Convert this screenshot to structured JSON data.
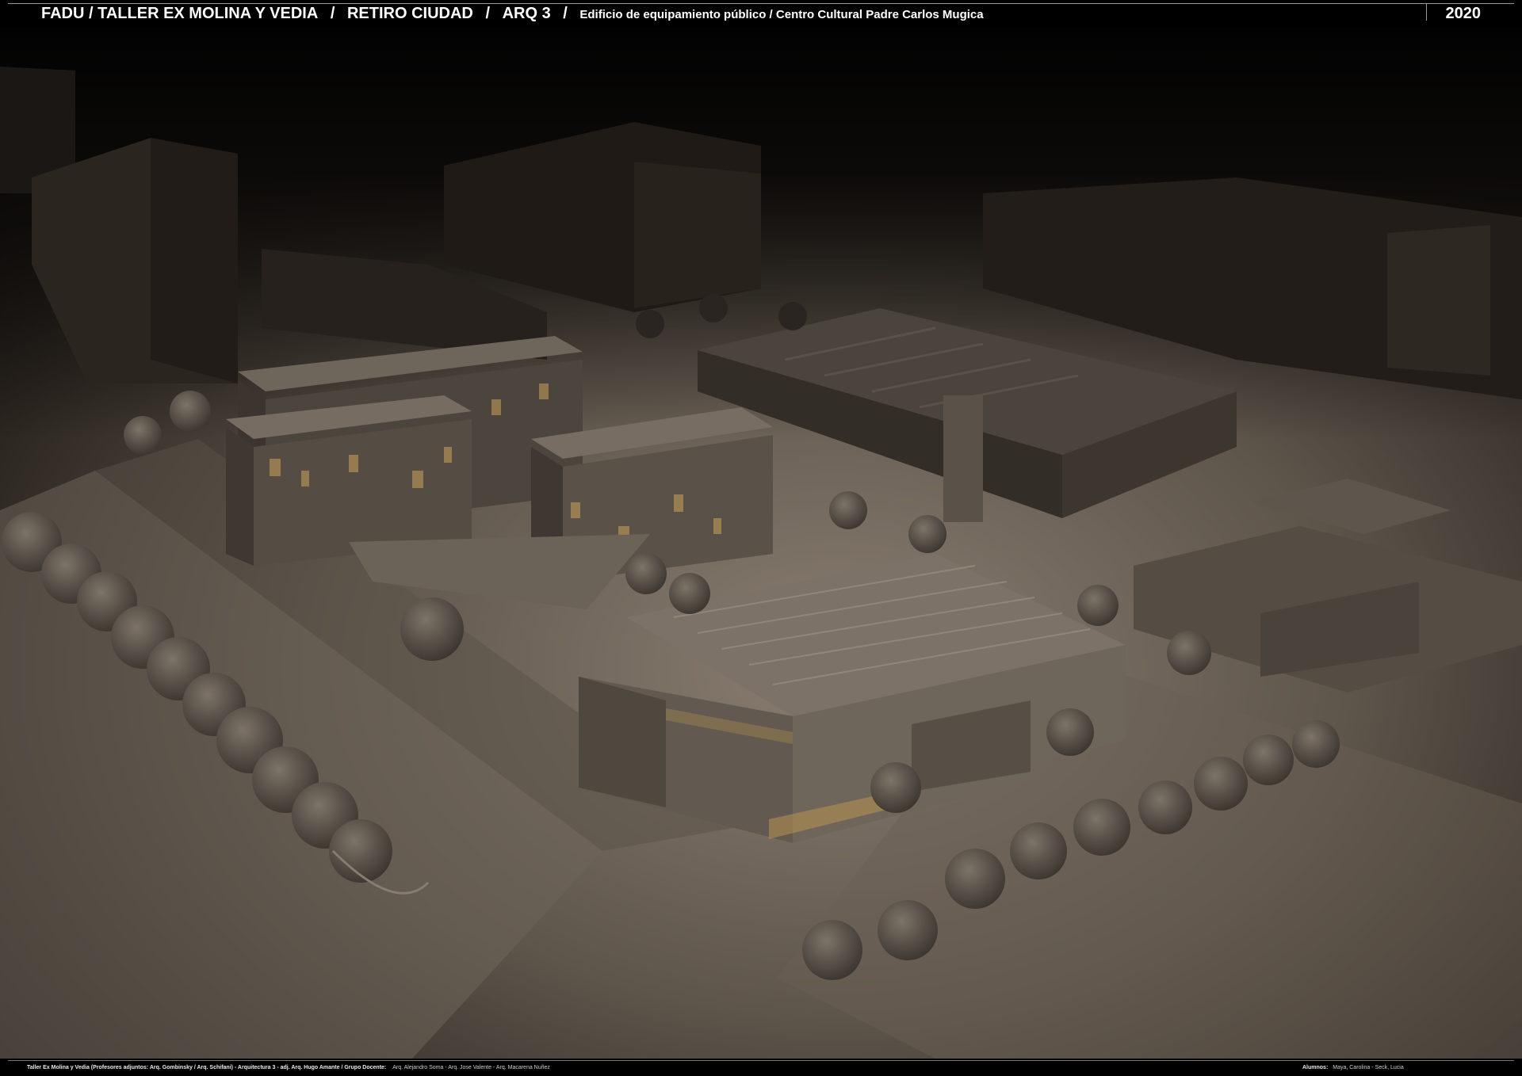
{
  "header": {
    "school": "FADU / TALLER EX MOLINA Y VEDIA",
    "site": "RETIRO CIUDAD",
    "course": "ARQ 3",
    "project": "Edificio de equipamiento público / Centro Cultural Padre Carlos Mugica",
    "year": "2020",
    "separator": "/"
  },
  "footer": {
    "credits": "Taller Ex Molina y Vedia (Profesores adjuntos:  Arq. Gombinsky / Arq. Schifani) - Arquitectura 3 - adj. Arq. Hugo Amante / Grupo Docente:",
    "teachers": "Arq. Alejandro Soma - Arq. Jose Valente - Arq. Macarena Nuñez",
    "students_label": "Alumnos:",
    "students": "Maya, Carolina - Seck, Lucia"
  },
  "render": {
    "description_icon": "architectural-render-image",
    "colors": {
      "sky": "#050403",
      "ground_light": "#7a6e62",
      "ground_dark": "#2a241f",
      "building": "#6b6157",
      "building_dark": "#3a332c",
      "window_glow": "#c9a25a",
      "tree": "#4a433c"
    }
  }
}
